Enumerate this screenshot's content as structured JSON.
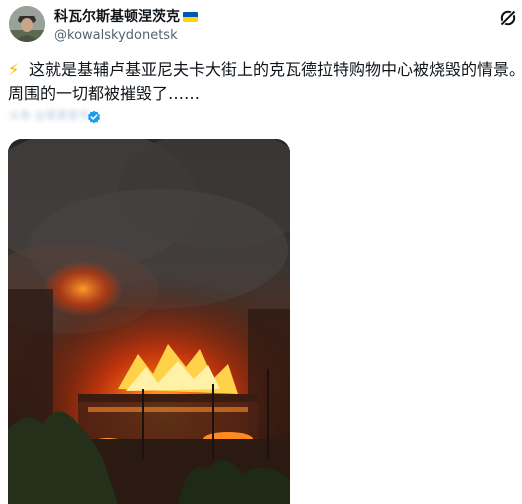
{
  "author": {
    "display_name": "科瓦尔斯基顿涅茨克",
    "flag_icon": "ukraine-flag-icon",
    "flag_colors": [
      "#0057b7",
      "#ffd700"
    ],
    "handle": "@kowalskydonetsk"
  },
  "post": {
    "emoji": "⚡",
    "text_line_1": "这就是基辅卢基亚尼夫卡大街上的克瓦德拉特购物中心被烧毁的情景。",
    "text_line_2": "周围的一切都被摧毁了……",
    "watermark": "头条 @某某某号"
  },
  "icons": {
    "grok": "grok-icon",
    "verified": "verified-badge-icon",
    "lightning": "lightning-icon"
  },
  "colors": {
    "text": "#0f1419",
    "secondary": "#536471",
    "verified_blue": "#1d9bf0"
  }
}
